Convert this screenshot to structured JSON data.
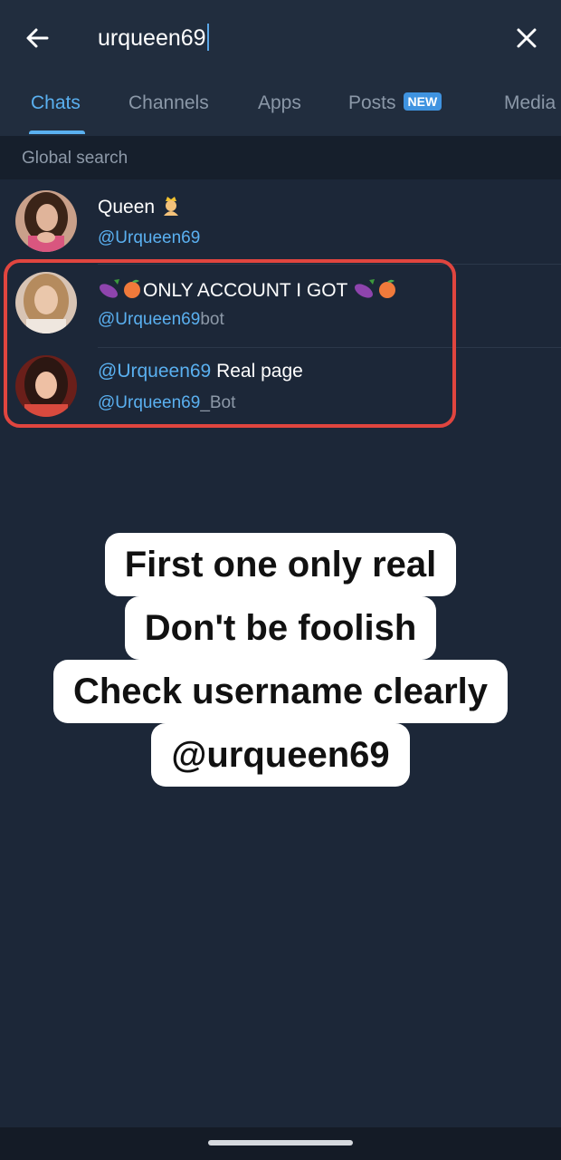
{
  "search": {
    "query": "urqueen69"
  },
  "tabs": [
    {
      "label": "Chats",
      "active": true
    },
    {
      "label": "Channels",
      "active": false
    },
    {
      "label": "Apps",
      "active": false
    },
    {
      "label": "Posts",
      "active": false,
      "badge": "NEW"
    },
    {
      "label": "Media",
      "active": false
    }
  ],
  "section": {
    "title": "Global search"
  },
  "results": [
    {
      "title": "Queen",
      "title_icon": "princess-emoji-icon",
      "username": "@Urqueen69"
    },
    {
      "title_text": "ONLY ACCOUNT I GOT",
      "title_icons": [
        "eggplant-emoji-icon",
        "peach-emoji-icon"
      ],
      "username_prefix": "@Urqueen69",
      "username_suffix": "bot"
    },
    {
      "title_mention": "@Urqueen69",
      "title_text": " Real page",
      "username_prefix": "@Urqueen69",
      "username_suffix": "_Bot"
    }
  ],
  "caption": {
    "lines": [
      "First one only real",
      "Don't be foolish",
      "Check username clearly",
      "@urqueen69"
    ]
  },
  "colors": {
    "accent": "#5ab0f0",
    "highlight_border": "#e0453f",
    "background": "#1c2738"
  }
}
